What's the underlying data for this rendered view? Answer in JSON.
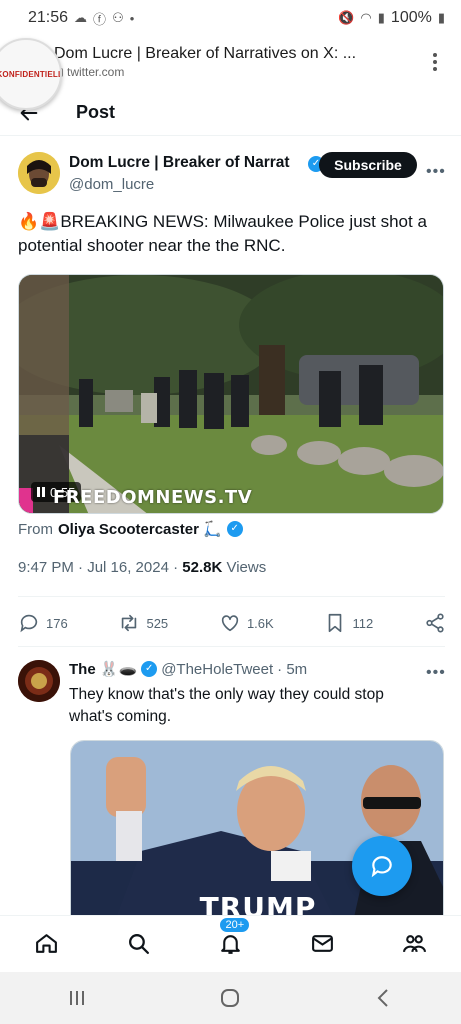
{
  "status_bar": {
    "time": "21:56",
    "battery": "100%"
  },
  "browser": {
    "badge_text": "KONFIDENTIELLT",
    "title": "Dom Lucre | Breaker of Narratives on X: ...",
    "url": "twitter.com"
  },
  "header": {
    "title": "Post"
  },
  "tweet": {
    "author_name": "Dom Lucre | Breaker of Narrat",
    "handle": "@dom_lucre",
    "subscribe_label": "Subscribe",
    "text": "🔥🚨BREAKING NEWS: Milwaukee Police just shot a potential shooter near the the RNC.",
    "video_time": "0:55",
    "watermark": "FREEDOMNEWS.TV",
    "from_prefix": "From",
    "from_name": "Oliya Scootercaster 🛴",
    "timestamp": "9:47 PM · Jul 16, 2024 · ",
    "views_count": "52.8K",
    "views_label": " Views",
    "stats": {
      "replies": "176",
      "reposts": "525",
      "likes": "1.6K",
      "bookmarks": "112"
    }
  },
  "reply": {
    "name": "The 🐰🕳️",
    "handle": "@TheHoleTweet",
    "time": "· 5m",
    "text": "They know that's the only way they could stop what's coming.",
    "image_caption": "TRUMP"
  },
  "bottom_nav": {
    "notifications_badge": "20+"
  },
  "colors": {
    "accent": "#1d9bf0",
    "text": "#0f1419",
    "secondary": "#536471"
  }
}
